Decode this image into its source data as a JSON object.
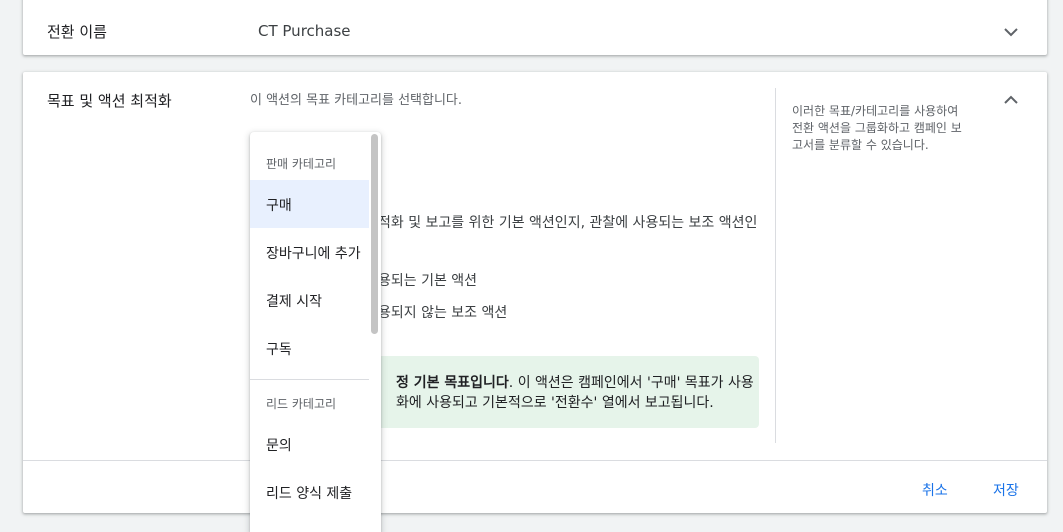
{
  "name_row": {
    "label": "전환 이름",
    "value": "CT Purchase",
    "expand_icon": "chevron-down-icon"
  },
  "goal_section": {
    "label": "목표 및 액션 최적화",
    "description": "이 액션의 목표 카테고리를 선택합니다.",
    "collapse_icon": "chevron-up-icon",
    "help_lines": [
      "이러한 목표/카테고리를 사용하여",
      "전환 액션을 그룹화하고 캠페인 보",
      "고서를 분류할 수 있습니다."
    ],
    "optimization_text": "적화 및 보고를 위한 기본 액션인지, 관찰에 사용되는 보조 액션인",
    "option_primary": "용되는 기본 액션",
    "option_secondary": "용되지 않는 보조 액션",
    "info": {
      "bold": "정 기본 목표입니다",
      "line1_rest": ". 이 액션은 캠페인에서 '구매' 목표가 사용",
      "line2": "화에 사용되고 기본적으로 '전환수' 열에서 보고됩니다."
    }
  },
  "footer": {
    "cancel": "취소",
    "save": "저장"
  },
  "dropdown": {
    "groups": [
      {
        "label": "판매 카테고리",
        "items": [
          "구매",
          "장바구니에 추가",
          "결제 시작",
          "구독"
        ]
      },
      {
        "label": "리드 카테고리",
        "items": [
          "문의",
          "리드 양식 제출"
        ]
      }
    ],
    "selected": "구매"
  },
  "colors": {
    "accent": "#1a73e8",
    "selected_bg": "#e8f0fe",
    "info_bg": "#e6f4ea"
  }
}
